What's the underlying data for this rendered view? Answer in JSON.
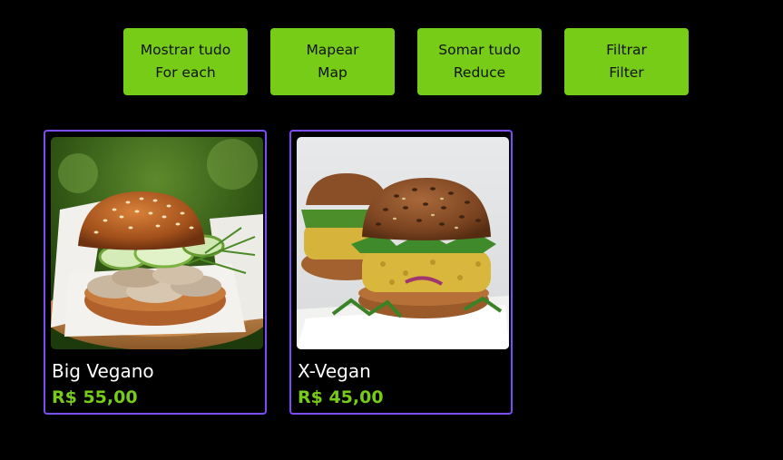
{
  "colors": {
    "background": "#000000",
    "button": "#76cc17",
    "button_text": "#111111",
    "card_border": "#7c4df5",
    "price": "#76cc17",
    "name": "#ffffff"
  },
  "actions": [
    {
      "line1": "Mostrar tudo",
      "line2": "For each"
    },
    {
      "line1": "Mapear",
      "line2": "Map"
    },
    {
      "line1": "Somar tudo",
      "line2": "Reduce"
    },
    {
      "line1": "Filtrar",
      "line2": "Filter"
    }
  ],
  "products": [
    {
      "name": "Big Vegano",
      "price": "R$ 55,00",
      "image": "burger-cucumber-photo"
    },
    {
      "name": "X-Vegan",
      "price": "R$ 45,00",
      "image": "burger-veggie-patty-photo"
    }
  ]
}
